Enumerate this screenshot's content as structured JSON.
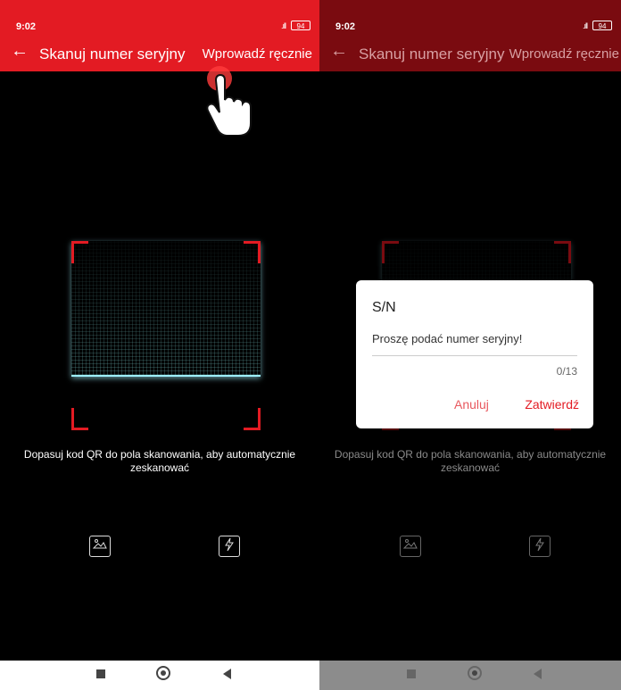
{
  "left_screen": {
    "status": {
      "time": "9:02",
      "signal": ".ıll",
      "battery": "94"
    },
    "appbar": {
      "back": "←",
      "title": "Skanuj numer seryjny",
      "action": "Wprowadź ręcznie"
    },
    "hint": "Dopasuj kod QR do pola skanowania, aby automatycznie zeskanować",
    "icons": [
      "gallery-icon",
      "flashlight-icon"
    ]
  },
  "right_screen": {
    "status": {
      "time": "9:02",
      "signal": ".ıll",
      "battery": "94"
    },
    "appbar": {
      "back": "←",
      "title": "Skanuj numer seryjny",
      "action": "Wprowadź ręcznie"
    },
    "hint": "Dopasuj kod QR do pola skanowania, aby automatycznie zeskanować",
    "dialog": {
      "title": "S/N",
      "placeholder": "Proszę podać numer seryjny!",
      "counter": "0/13",
      "cancel": "Anuluj",
      "confirm": "Zatwierdź"
    }
  },
  "colors": {
    "accent": "#e31b23",
    "dark_appbar": "#7a0b10"
  }
}
